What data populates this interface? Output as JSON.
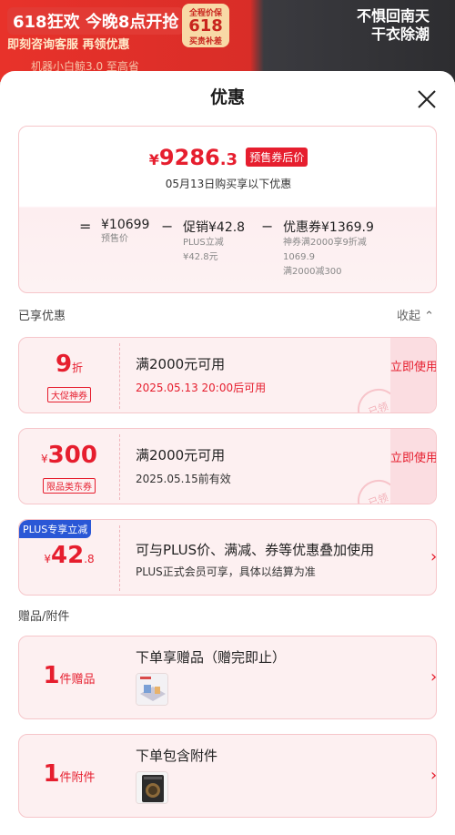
{
  "background": {
    "line1": "618狂欢 今晚8点开抢",
    "line2": "即刻咨询客服 再领优惠",
    "badge_top": "全程价保",
    "badge_num": "618",
    "badge_bottom": "买贵补差",
    "right_line1": "不惧回南天",
    "right_line2": "干衣除潮",
    "line3": "机器小白鲸3.0 至高省"
  },
  "sheet": {
    "title": "优惠"
  },
  "summary": {
    "yen": "¥",
    "price_int": "9286",
    "price_dec": ".3",
    "price_tag": "预售券后价",
    "date_text": "05月13日购买享以下优惠",
    "op_eq": "=",
    "op_minus1": "−",
    "op_minus2": "−",
    "presale_value": "¥10699",
    "presale_label": "预售价",
    "promo_value": "促销¥42.8",
    "promo_sub1": "PLUS立减",
    "promo_sub2": "¥42.8元",
    "coupon_value": "优惠券¥1369.9",
    "coupon_sub1": "神券满2000享9折减",
    "coupon_sub2": "1069.9",
    "coupon_sub3": "满2000减300"
  },
  "sections": {
    "enjoyed": "已享优惠",
    "collapse": "收起",
    "gifts": "赠品/附件"
  },
  "coupons": [
    {
      "value": "9",
      "unit": "折",
      "tag": "大促神券",
      "title": "满2000元可用",
      "sub": "2025.05.13 20:00后可用",
      "use": "立即使用",
      "stamp": "已领"
    },
    {
      "yen": "¥",
      "value": "300",
      "tag": "限品类东券",
      "title": "满2000元可用",
      "sub": "2025.05.15前有效",
      "use": "立即使用",
      "stamp": "已领"
    }
  ],
  "plus_offer": {
    "badge": "PLUS专享立减",
    "yen": "¥",
    "value": "42",
    "dec": ".8",
    "title": "可与PLUS价、满减、券等优惠叠加使用",
    "sub": "PLUS正式会员可享，具体以结算为准"
  },
  "gifts": [
    {
      "count": "1",
      "unit": "件赠品",
      "title": "下单享赠品（赠完即止）"
    },
    {
      "count": "1",
      "unit": "件附件",
      "title": "下单包含附件"
    }
  ],
  "colors": {
    "accent": "#e61e2e",
    "plus_blue": "#2a57d6"
  }
}
